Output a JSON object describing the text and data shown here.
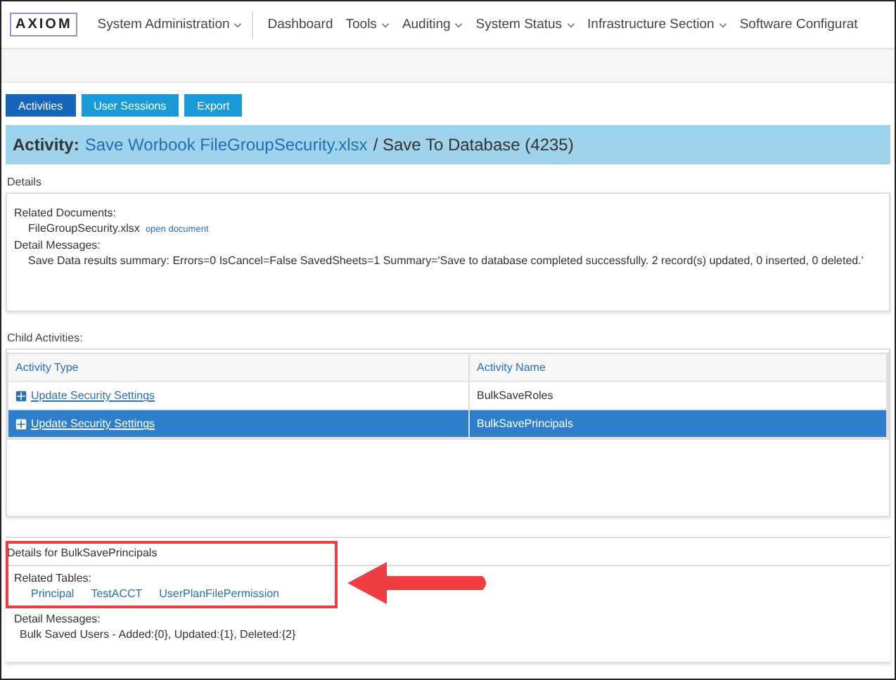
{
  "navbar": {
    "logo": "AXIOM",
    "menus": [
      {
        "label": "System Administration",
        "dropdown": true
      },
      {
        "label": "Dashboard",
        "dropdown": false
      },
      {
        "label": "Tools",
        "dropdown": true
      },
      {
        "label": "Auditing",
        "dropdown": true
      },
      {
        "label": "System Status",
        "dropdown": true
      },
      {
        "label": "Infrastructure Section",
        "dropdown": true
      },
      {
        "label": "Software Configurat",
        "dropdown": false
      }
    ]
  },
  "tabs": [
    {
      "label": "Activities",
      "selected": true
    },
    {
      "label": "User Sessions",
      "selected": false
    },
    {
      "label": "Export",
      "selected": false
    }
  ],
  "activity_header": {
    "label": "Activity:",
    "link": "Save Worbook FileGroupSecurity.xlsx",
    "rest": "/ Save To Database (4235)"
  },
  "details": {
    "title": "Details",
    "related_documents_label": "Related Documents:",
    "document": "FileGroupSecurity.xlsx",
    "document_link": "open document",
    "detail_messages_label": "Detail Messages:",
    "message": "Save Data results summary: Errors=0 IsCancel=False SavedSheets=1 Summary='Save to database completed successfully. 2 record(s) updated, 0 inserted, 0 deleted.'"
  },
  "child_activities": {
    "title": "Child Activities:",
    "columns": [
      "Activity Type",
      "Activity Name"
    ],
    "rows": [
      {
        "type": "Update Security Settings",
        "name": "BulkSaveRoles",
        "selected": false
      },
      {
        "type": "Update Security Settings",
        "name": "BulkSavePrincipals",
        "selected": true
      }
    ]
  },
  "sub_details": {
    "title": "Details for BulkSavePrincipals",
    "related_tables_label": "Related Tables:",
    "tables": [
      "Principal",
      "TestACCT",
      "UserPlanFilePermission"
    ],
    "detail_messages_label": "Detail Messages:",
    "message": "Bulk Saved Users - Added:{0}, Updated:{1}, Deleted:{2}"
  }
}
